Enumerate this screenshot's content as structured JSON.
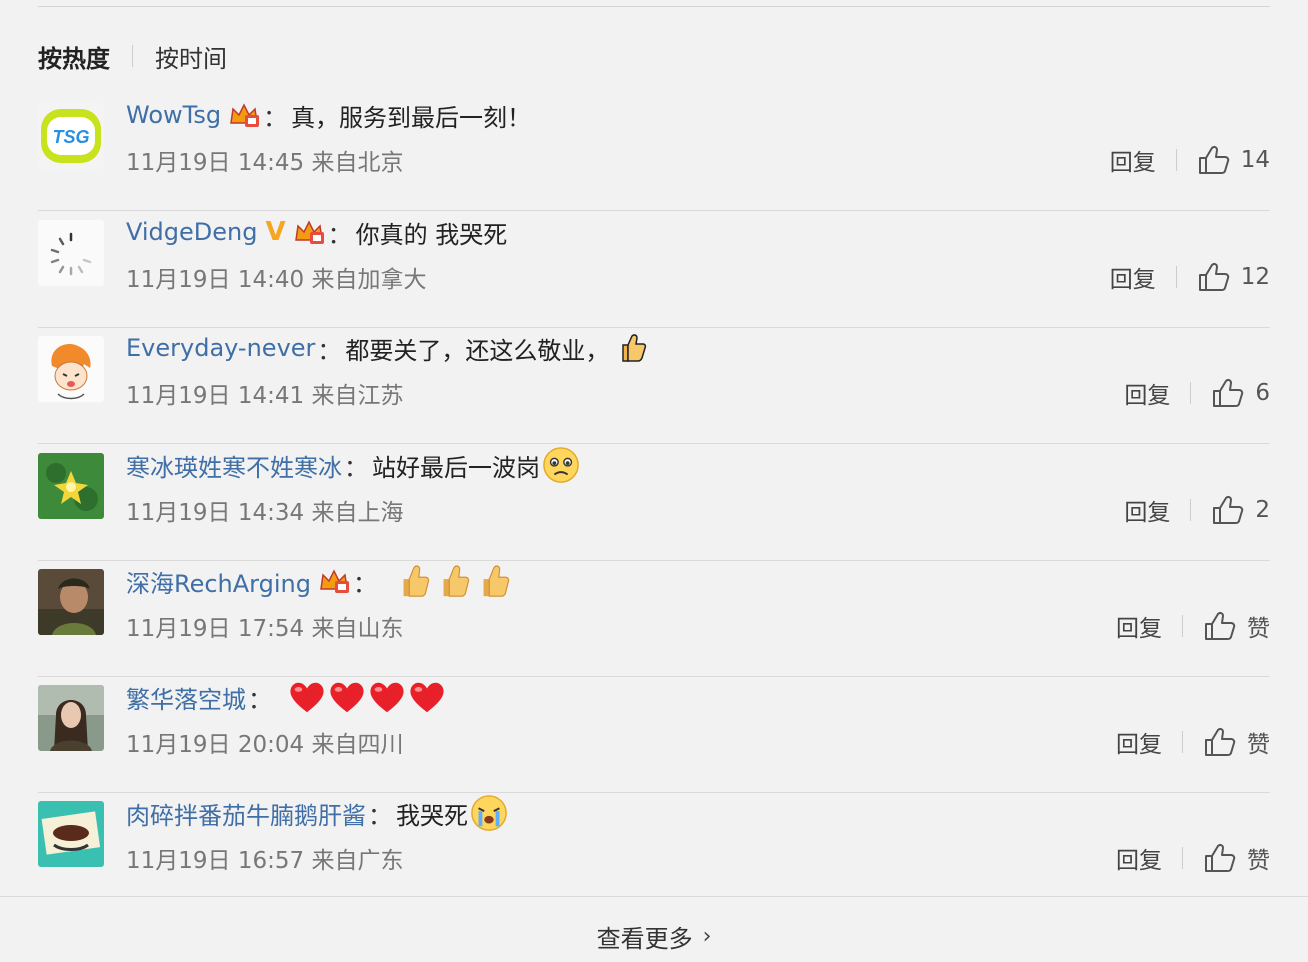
{
  "sort": {
    "hot": "按热度",
    "time": "按时间"
  },
  "action_labels": {
    "reply": "回复"
  },
  "comments": [
    {
      "user": "WowTsg",
      "colon": "：",
      "text": "真，服务到最后一刻！",
      "meta": "11月19日 14:45 来自北京",
      "likes": "14",
      "avatar_text": "TSG"
    },
    {
      "user": "VidgeDeng",
      "colon": "：",
      "text": "你真的 我哭死",
      "meta": "11月19日 14:40 来自加拿大",
      "likes": "12",
      "vbadge": "V"
    },
    {
      "user": "Everyday-never",
      "colon": "：",
      "text": "都要关了，还这么敬业，",
      "meta": "11月19日 14:41 来自江苏",
      "likes": "6"
    },
    {
      "user": "寒冰瑛姓寒不姓寒冰",
      "colon": "：",
      "text": "站好最后一波岗",
      "meta": "11月19日 14:34 来自上海",
      "likes": "2"
    },
    {
      "user": "深海RechArging",
      "colon": "：",
      "text": "",
      "meta": "11月19日 17:54 来自山东",
      "likes": "赞"
    },
    {
      "user": "繁华落空城",
      "colon": "：",
      "text": "",
      "meta": "11月19日 20:04 来自四川",
      "likes": "赞"
    },
    {
      "user": "肉碎拌番茄牛腩鹅肝酱",
      "colon": "：",
      "text": "我哭死",
      "meta": "11月19日 16:57 来自广东",
      "likes": "赞"
    }
  ],
  "footer": {
    "more": "查看更多",
    "chevron": "›"
  },
  "colors": {
    "username": "#3f6fa6",
    "background": "#f2f2f2",
    "meta": "#777777"
  }
}
